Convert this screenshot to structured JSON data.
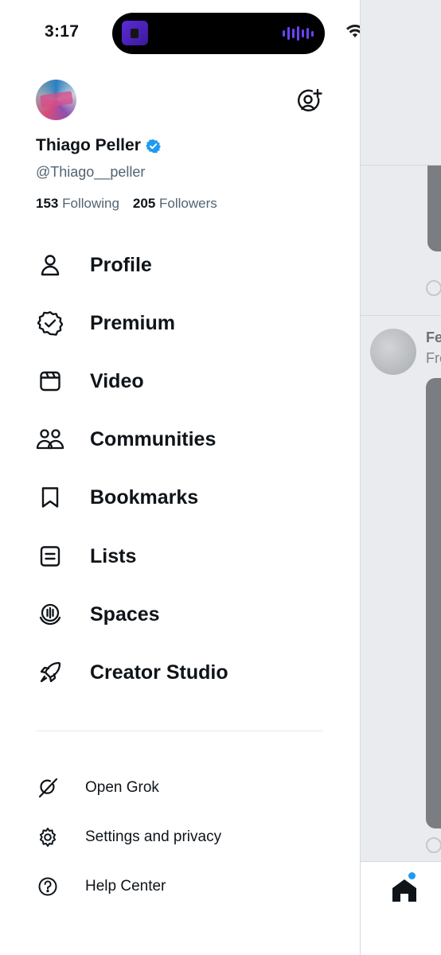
{
  "status_bar": {
    "time": "3:17"
  },
  "profile": {
    "name": "Thiago Peller",
    "handle": "@Thiago__peller",
    "following_count": "153",
    "following_label": "Following",
    "followers_count": "205",
    "followers_label": "Followers"
  },
  "menu": [
    {
      "label": "Profile",
      "icon": "person-icon"
    },
    {
      "label": "Premium",
      "icon": "verified-badge-icon"
    },
    {
      "label": "Video",
      "icon": "video-icon"
    },
    {
      "label": "Communities",
      "icon": "communities-icon"
    },
    {
      "label": "Bookmarks",
      "icon": "bookmark-icon"
    },
    {
      "label": "Lists",
      "icon": "list-icon"
    },
    {
      "label": "Spaces",
      "icon": "spaces-icon"
    },
    {
      "label": "Creator Studio",
      "icon": "rocket-icon"
    }
  ],
  "secondary_menu": [
    {
      "label": "Open Grok",
      "icon": "grok-icon"
    },
    {
      "label": "Settings and privacy",
      "icon": "gear-icon"
    },
    {
      "label": "Help Center",
      "icon": "help-icon"
    }
  ],
  "background_feed": {
    "author_fragment": "Fe",
    "text_fragment": "Fre"
  },
  "colors": {
    "verified_blue": "#1d9bf0",
    "text_primary": "#0f1419",
    "text_secondary": "#536471"
  }
}
